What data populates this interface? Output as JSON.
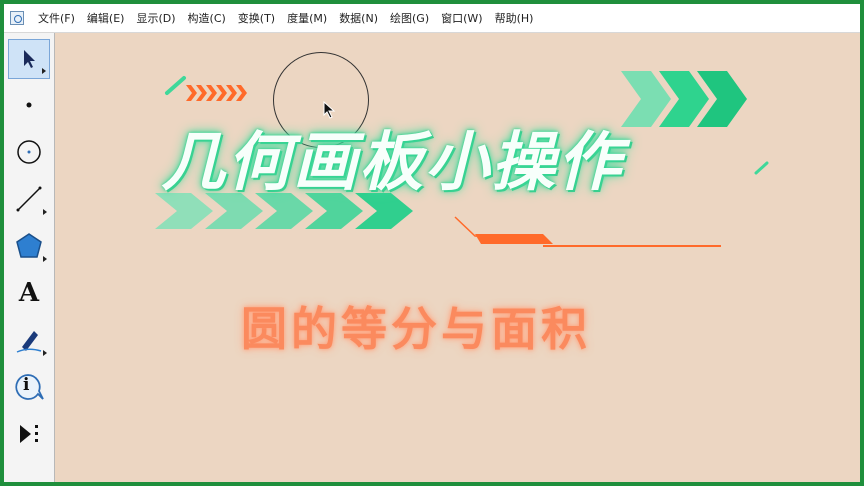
{
  "menubar": {
    "items": [
      "文件(F)",
      "编辑(E)",
      "显示(D)",
      "构造(C)",
      "变换(T)",
      "度量(M)",
      "数据(N)",
      "绘图(G)",
      "窗口(W)",
      "帮助(H)"
    ]
  },
  "toolbox": {
    "tools": [
      "arrow-select-icon",
      "point-icon",
      "compass-icon",
      "straightedge-icon",
      "polygon-icon",
      "text-tool-icon",
      "marker-icon",
      "info-icon",
      "custom-tools-icon"
    ],
    "text_tool_glyph": "A",
    "info_glyph": "i"
  },
  "canvas": {
    "title": "几何画板小操作",
    "subtitle": "圆的等分与面积"
  },
  "colors": {
    "frame_border": "#1f8f3c",
    "canvas_bg": "#ecd6c2",
    "accent_green": "#36d696",
    "accent_orange": "#ff6a2a",
    "subtitle_orange": "#fb8a5e"
  }
}
